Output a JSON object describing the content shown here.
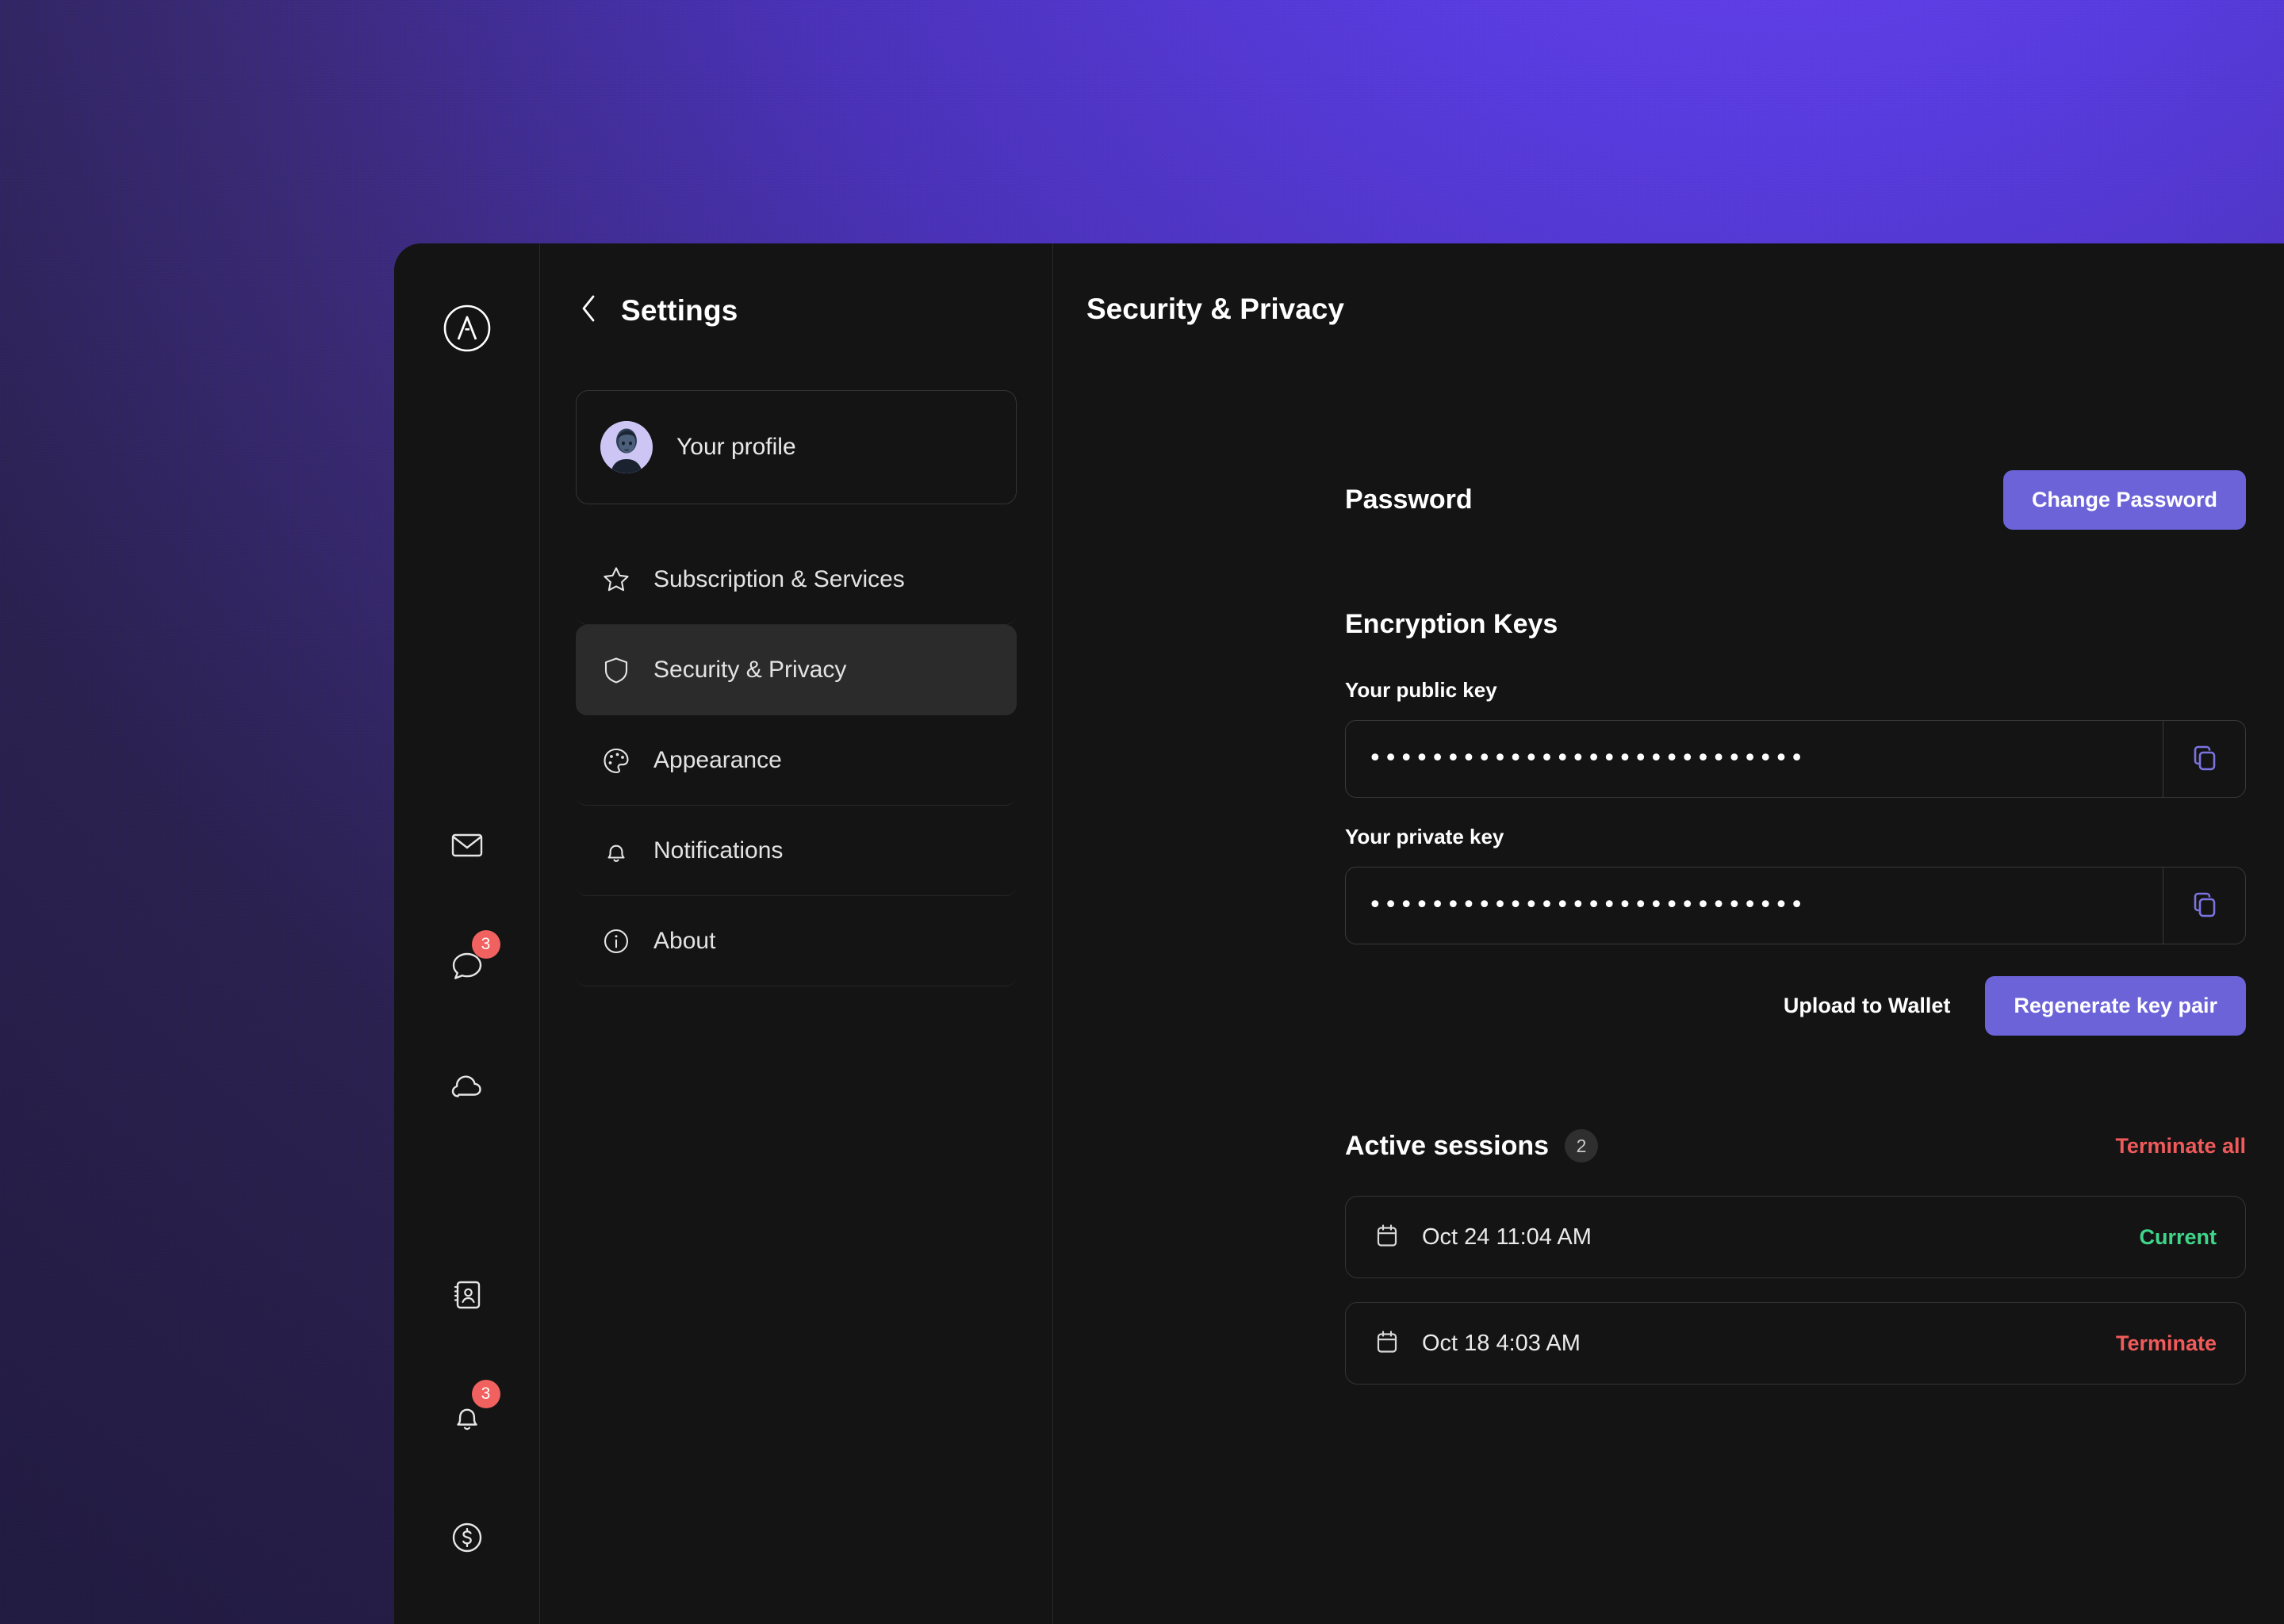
{
  "wallpaper": {
    "accent": "#5B3FE0"
  },
  "rail": {
    "logo_icon": "app-logo-a-circle",
    "items": [
      {
        "icon": "mail-icon",
        "name": "mail",
        "badge": null
      },
      {
        "icon": "chat-icon",
        "name": "chat",
        "badge": "3"
      },
      {
        "icon": "cloud-icon",
        "name": "cloud",
        "badge": null
      },
      {
        "icon": "contacts-icon",
        "name": "contacts",
        "badge": null
      },
      {
        "icon": "bell-icon",
        "name": "notifications",
        "badge": "3"
      },
      {
        "icon": "dollar-circle-icon",
        "name": "wallet",
        "badge": null
      }
    ]
  },
  "settings_nav": {
    "back_icon": "chevron-left-icon",
    "title": "Settings",
    "profile": {
      "label": "Your profile",
      "avatar_icon": "avatar"
    },
    "items": [
      {
        "label": "Subscription & Services",
        "icon": "star-icon",
        "active": false
      },
      {
        "label": "Security & Privacy",
        "icon": "shield-icon",
        "active": true
      },
      {
        "label": "Appearance",
        "icon": "palette-icon",
        "active": false
      },
      {
        "label": "Notifications",
        "icon": "bell-icon",
        "active": false
      },
      {
        "label": "About",
        "icon": "info-circle-icon",
        "active": false
      }
    ]
  },
  "main": {
    "title": "Security & Privacy",
    "password": {
      "heading": "Password",
      "change_button": "Change Password"
    },
    "encryption": {
      "heading": "Encryption Keys",
      "public_key_label": "Your public key",
      "public_key_value": "••••••••••••••••••••••••••••",
      "private_key_label": "Your private key",
      "private_key_value": "••••••••••••••••••••••••••••",
      "copy_icon": "copy-icon",
      "upload_button": "Upload to Wallet",
      "regenerate_button": "Regenerate key pair"
    },
    "sessions": {
      "heading": "Active sessions",
      "count": "2",
      "terminate_all": "Terminate all",
      "rows": [
        {
          "icon": "calendar-icon",
          "date": "Oct 24 11:04 AM",
          "state": "Current",
          "state_kind": "current"
        },
        {
          "icon": "calendar-icon",
          "date": "Oct 18 4:03 AM",
          "state": "Terminate",
          "state_kind": "terminate"
        }
      ]
    }
  },
  "colors": {
    "accent": "#6C63D8",
    "danger": "#F05A5A",
    "success": "#3FD68A",
    "badge": "#F0615F"
  }
}
